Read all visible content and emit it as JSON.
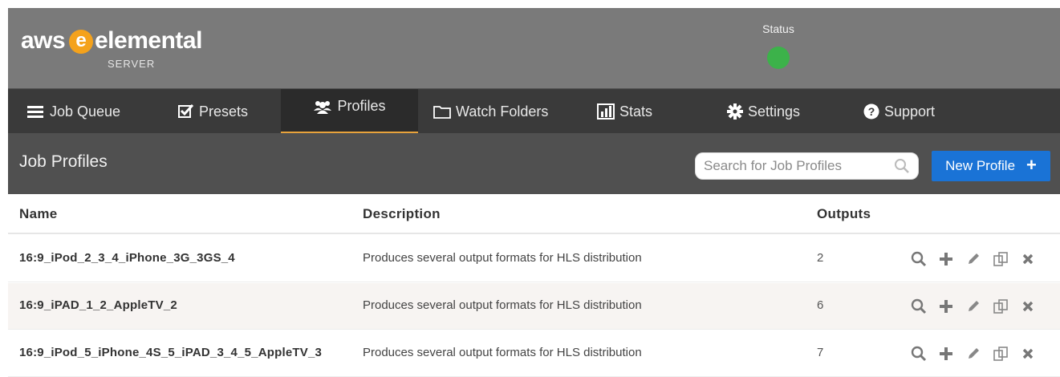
{
  "brand": {
    "aws": "aws",
    "e": "e",
    "elemental": "elemental",
    "server": "SERVER"
  },
  "status": {
    "label": "Status",
    "state_color": "#3cb24a"
  },
  "nav": {
    "items": [
      {
        "label": "Job Queue",
        "icon": "list-icon"
      },
      {
        "label": "Presets",
        "icon": "checkbox-icon"
      },
      {
        "label": "Profiles",
        "icon": "users-icon",
        "active": true
      },
      {
        "label": "Watch Folders",
        "icon": "folder-icon"
      },
      {
        "label": "Stats",
        "icon": "bar-chart-icon"
      },
      {
        "label": "Settings",
        "icon": "gear-icon"
      },
      {
        "label": "Support",
        "icon": "question-icon"
      }
    ]
  },
  "section": {
    "title": "Job Profiles",
    "search_placeholder": "Search for Job Profiles",
    "search_value": "",
    "new_button": "New Profile",
    "new_button_plus": "+"
  },
  "table": {
    "columns": [
      "Name",
      "Description",
      "Outputs"
    ],
    "rows": [
      {
        "name": "16:9_iPod_2_3_4_iPhone_3G_3GS_4",
        "description": "Produces several output formats for HLS distribution",
        "outputs": "2"
      },
      {
        "name": "16:9_iPAD_1_2_AppleTV_2",
        "description": "Produces several output formats for HLS distribution",
        "outputs": "6"
      },
      {
        "name": "16:9_iPod_5_iPhone_4S_5_iPAD_3_4_5_AppleTV_3",
        "description": "Produces several output formats for HLS distribution",
        "outputs": "7"
      }
    ],
    "row_actions": [
      "view-icon",
      "add-icon",
      "edit-icon",
      "copy-icon",
      "delete-icon"
    ]
  },
  "colors": {
    "header_bg": "#7a7a7a",
    "nav_bg": "#3a3a3a",
    "active_tab_underline": "#e8a33c",
    "section_bg": "#505050",
    "primary_button": "#1a73d6",
    "logo_accent": "#f4a21c"
  }
}
